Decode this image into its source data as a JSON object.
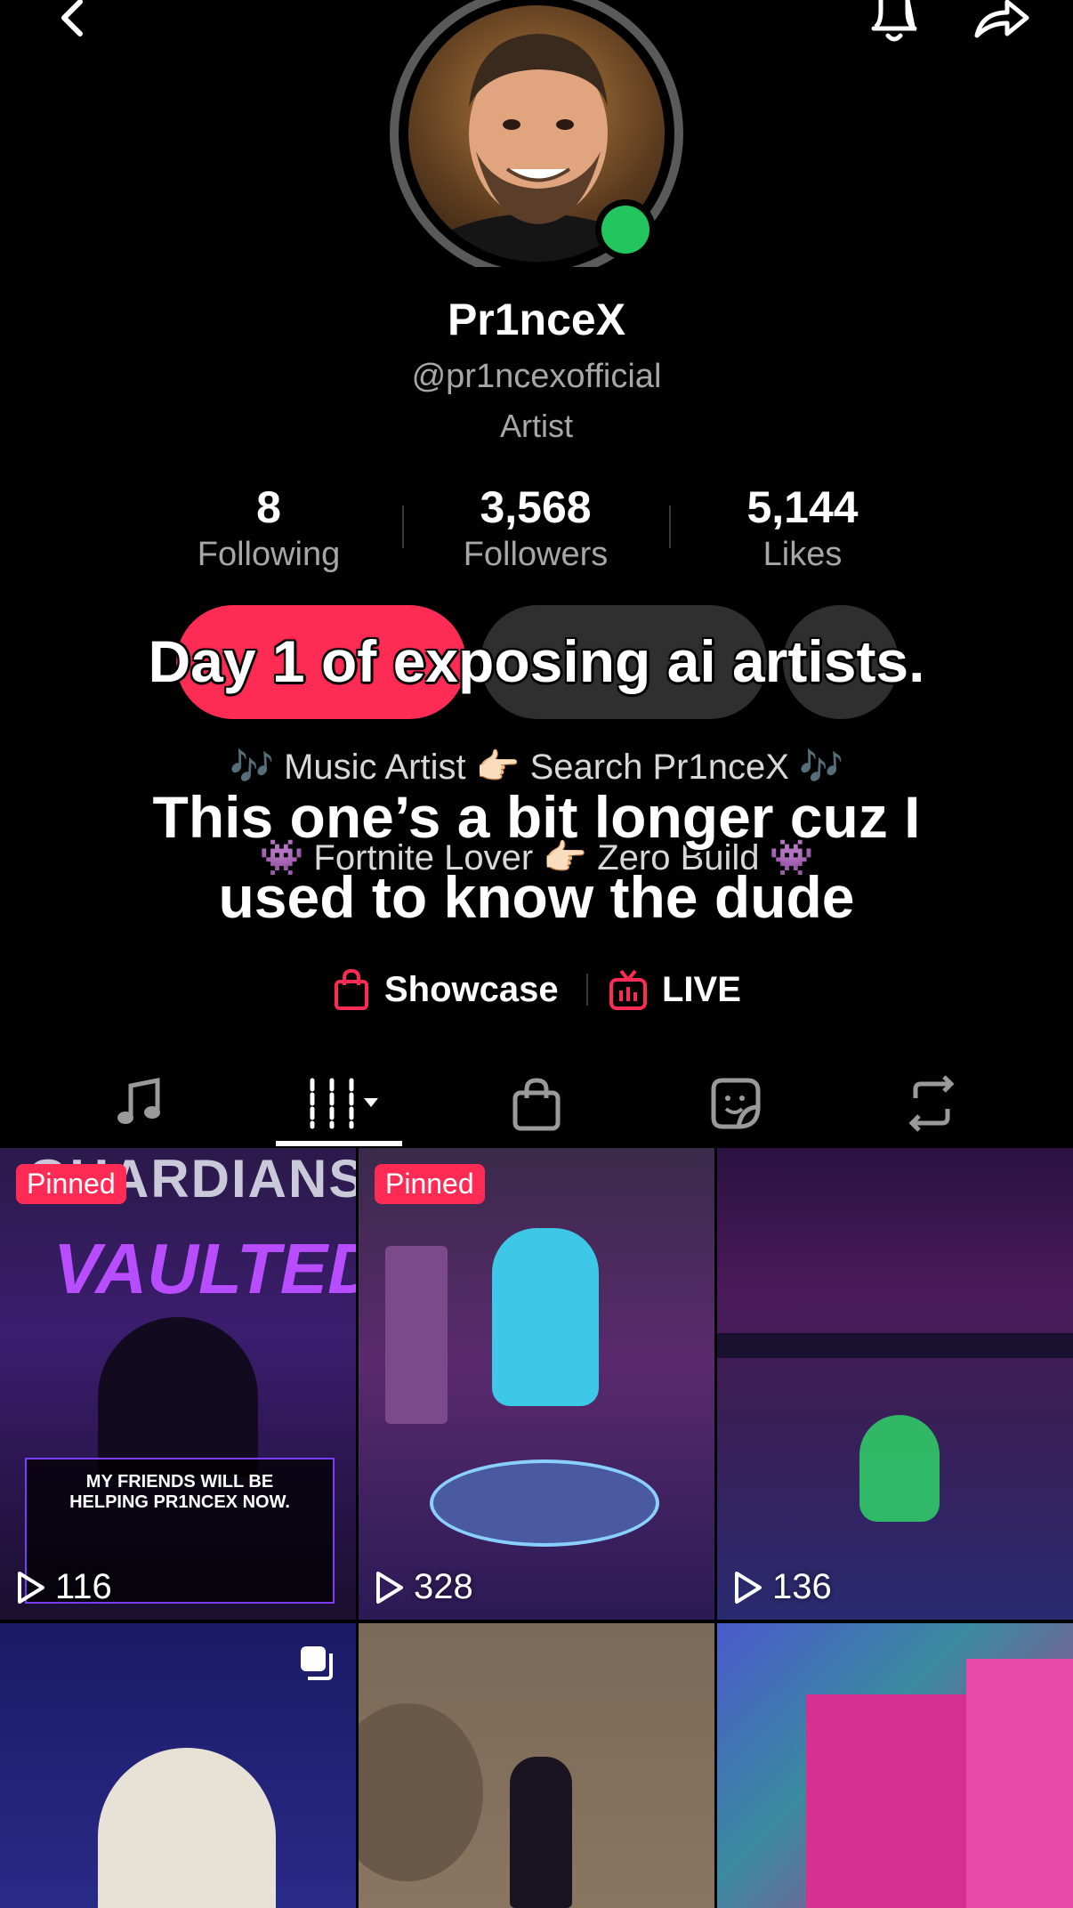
{
  "profile": {
    "display_name": "Pr1nceX",
    "handle": "@pr1ncexofficial",
    "category": "Artist",
    "online_color": "#22c55e"
  },
  "stats": [
    {
      "value": "8",
      "label": "Following"
    },
    {
      "value": "3,568",
      "label": "Followers"
    },
    {
      "value": "5,144",
      "label": "Likes"
    }
  ],
  "buttons": {
    "primary_color": "#fe2c55",
    "secondary_color": "#2f2f2f"
  },
  "bio": {
    "line1": "🎶 Music Artist 👉🏻 Search Pr1nceX 🎶",
    "line3": "👾 Fortnite Lover 👉🏻  Zero Build 👾"
  },
  "overlay_caption": {
    "line1": "Day 1 of exposing ai artists.",
    "line2": "This one’s a bit longer cuz I",
    "line3": "used to know the dude"
  },
  "links": {
    "showcase": "Showcase",
    "live": "LIVE",
    "accent": "#fe2c55"
  },
  "tabs": [
    "music-icon",
    "videos-grid-icon",
    "shop-bag-icon",
    "sticker-icon",
    "repost-icon"
  ],
  "grid": [
    {
      "pinned": "Pinned",
      "views": "116",
      "headline": "MY FRIENDS WILL BE HELPING PR1NCEX NOW."
    },
    {
      "pinned": "Pinned",
      "views": "328"
    },
    {
      "views": "136"
    },
    {
      "multi": true
    },
    {},
    {}
  ]
}
